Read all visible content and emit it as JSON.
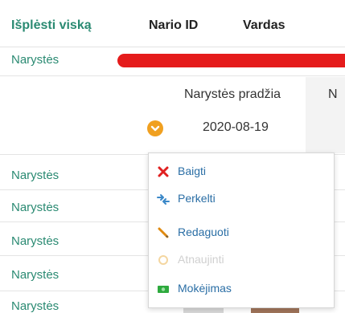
{
  "header": {
    "expand_all": "Išplėsti viską",
    "col_member_id": "Nario ID",
    "col_name": "Vardas"
  },
  "rows": [
    {
      "label": "Narystės"
    },
    {
      "label": "Narystės"
    },
    {
      "label": "Narystės"
    },
    {
      "label": "Narystės"
    },
    {
      "label": "Narystės"
    },
    {
      "label": "Narystės"
    }
  ],
  "expanded": {
    "col_start": "Narystės pradžia",
    "col_next_trunc": "N",
    "start_date": "2020-08-19"
  },
  "menu": {
    "items": [
      {
        "label": "Baigti",
        "icon": "x-icon"
      },
      {
        "label": "Perkelti",
        "icon": "transfer-icon"
      },
      {
        "label": "Redaguoti",
        "icon": "pencil-icon"
      },
      {
        "label": "Atnaujinti",
        "icon": "refresh-icon",
        "disabled": true
      },
      {
        "label": "Mokėjimas",
        "icon": "money-icon"
      }
    ]
  },
  "colors": {
    "accent": "#2a8a72",
    "highlight_bar": "#e51b1b",
    "toggle": "#f0a020",
    "menu_link": "#2a6ea5"
  }
}
